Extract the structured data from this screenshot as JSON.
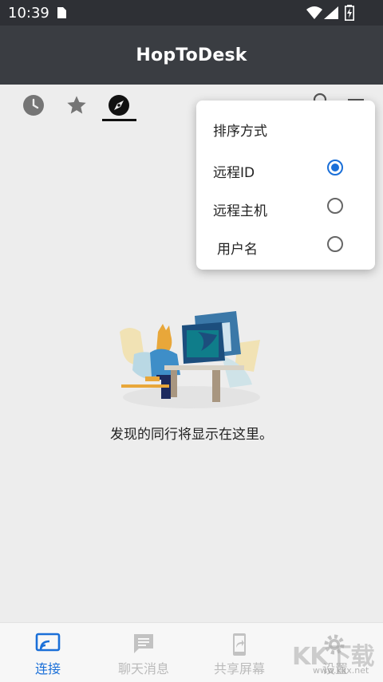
{
  "status_bar": {
    "time": "10:39"
  },
  "app_bar": {
    "title": "HopToDesk"
  },
  "tabs": [
    {
      "name": "recent",
      "icon": "clock-icon",
      "active": false
    },
    {
      "name": "favorites",
      "icon": "star-icon",
      "active": false
    },
    {
      "name": "discovered",
      "icon": "compass-icon",
      "active": true
    }
  ],
  "sort_popup": {
    "title": "排序方式",
    "options": [
      {
        "label": "远程ID",
        "selected": true
      },
      {
        "label": "远程主机",
        "selected": false
      },
      {
        "label": "用户名",
        "selected": false
      }
    ]
  },
  "empty_state": {
    "message": "发现的同行将显示在这里。"
  },
  "bottom_nav": [
    {
      "label": "连接",
      "icon": "cast-icon",
      "active": true
    },
    {
      "label": "聊天消息",
      "icon": "chat-icon",
      "active": false
    },
    {
      "label": "共享屏幕",
      "icon": "share-screen-icon",
      "active": false
    },
    {
      "label": "设置",
      "icon": "gear-icon",
      "active": false
    }
  ],
  "watermark": {
    "text": "KK下载",
    "url": "www.kkx.net"
  },
  "colors": {
    "accent": "#1a6fd8",
    "app_bar": "#3a3d42",
    "status_bar": "#2e3035",
    "background": "#ededed"
  }
}
